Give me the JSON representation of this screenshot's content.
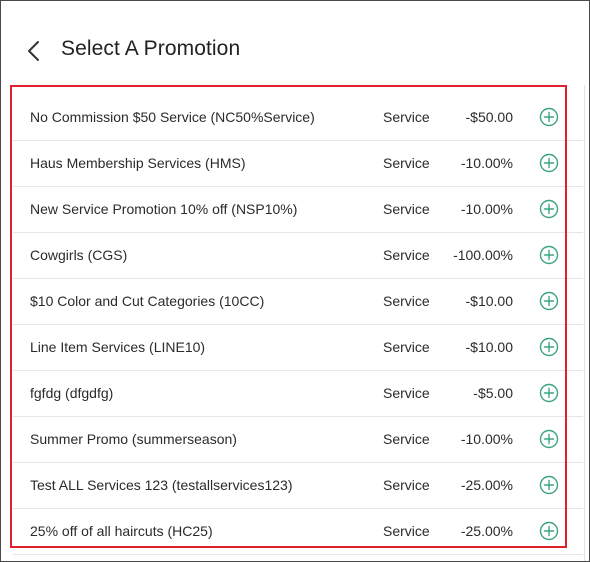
{
  "header": {
    "title": "Select A Promotion",
    "back_icon": "chevron-left-icon"
  },
  "colors": {
    "accent": "#3ba57e",
    "highlight_border": "#e0202a",
    "text": "#2b2b2b"
  },
  "promotions": [
    {
      "name": "No Commission $50 Service (NC50%Service)",
      "type": "Service",
      "amount": "-$50.00"
    },
    {
      "name": "Haus Membership Services (HMS)",
      "type": "Service",
      "amount": "-10.00%"
    },
    {
      "name": "New Service Promotion 10% off (NSP10%)",
      "type": "Service",
      "amount": "-10.00%"
    },
    {
      "name": "Cowgirls (CGS)",
      "type": "Service",
      "amount": "-100.00%"
    },
    {
      "name": "$10 Color and Cut Categories (10CC)",
      "type": "Service",
      "amount": "-$10.00"
    },
    {
      "name": "Line Item Services (LINE10)",
      "type": "Service",
      "amount": "-$10.00"
    },
    {
      "name": "fgfdg (dfgdfg)",
      "type": "Service",
      "amount": "-$5.00"
    },
    {
      "name": "Summer Promo (summerseason)",
      "type": "Service",
      "amount": "-10.00%"
    },
    {
      "name": "Test ALL Services 123 (testallservices123)",
      "type": "Service",
      "amount": "-25.00%"
    },
    {
      "name": "25% off of all haircuts (HC25)",
      "type": "Service",
      "amount": "-25.00%"
    }
  ],
  "row_add_icon": "plus-circle-icon"
}
